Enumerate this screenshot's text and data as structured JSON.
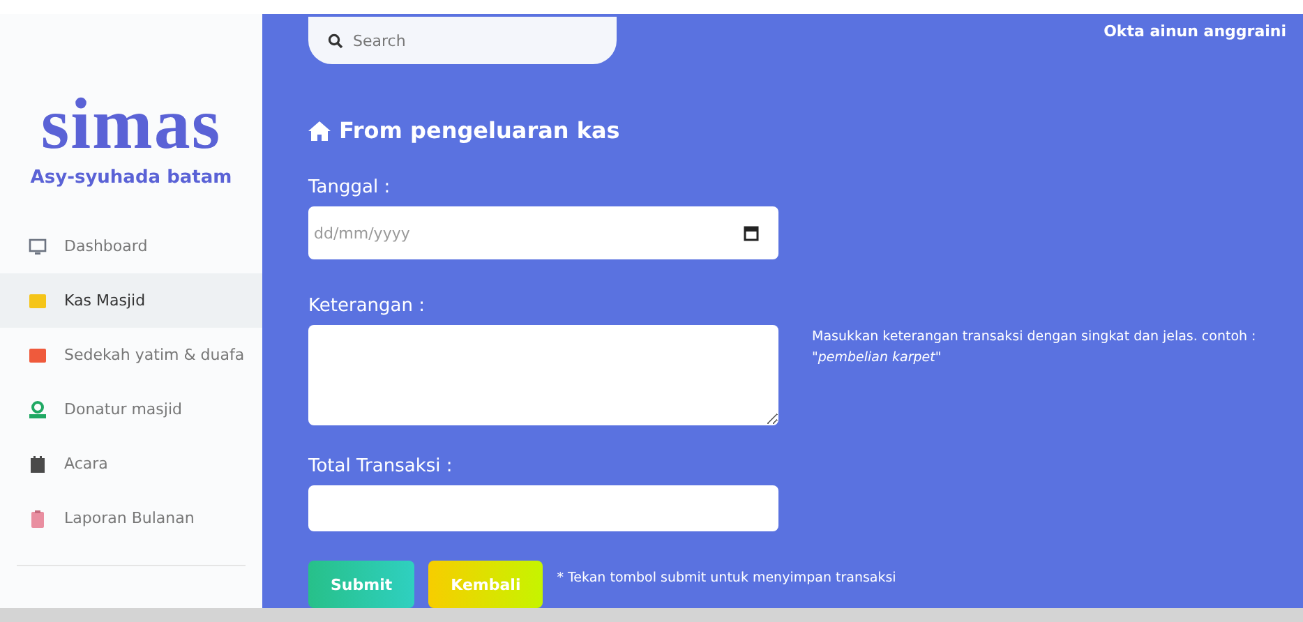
{
  "sidebar": {
    "logo": "simas",
    "tagline": "Asy-syuhada batam",
    "items": [
      {
        "label": "Dashboard",
        "color": "#6b7280",
        "selected": false
      },
      {
        "label": "Kas Masjid",
        "color": "#f5c518",
        "selected": true
      },
      {
        "label": "Sedekah yatim & duafa",
        "color": "#ef5a3c",
        "selected": false
      },
      {
        "label": "Donatur masjid",
        "color": "#1fa863",
        "selected": false
      },
      {
        "label": "Acara",
        "color": "#4a4a4a",
        "selected": false
      },
      {
        "label": "Laporan Bulanan",
        "color": "#e98ea0",
        "selected": false
      }
    ]
  },
  "topbar": {
    "search": {
      "placeholder": "Search"
    },
    "user": "Okta ainun anggraini"
  },
  "form": {
    "title": "From pengeluaran kas",
    "date": {
      "label": "Tanggal :",
      "placeholder": "dd/mm/yyyy"
    },
    "description": {
      "label": "Keterangan :",
      "hint": "Masukkan keterangan transaksi dengan singkat dan jelas. contoh :",
      "example": "\"pembelian karpet\""
    },
    "total": {
      "label": "Total Transaksi :"
    },
    "buttons": [
      {
        "label": "Submit",
        "kind": "submit"
      },
      {
        "label": "Kembali",
        "kind": "back"
      }
    ],
    "note": "* Tekan tombol submit untuk menyimpan transaksi"
  }
}
